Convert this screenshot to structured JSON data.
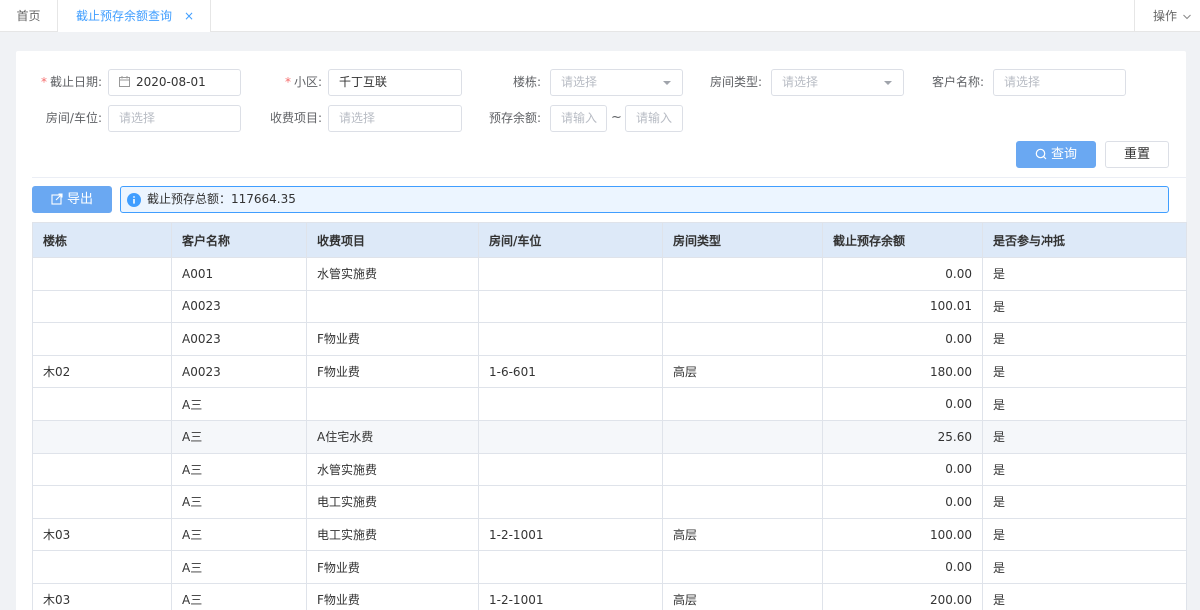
{
  "tabs": {
    "home": "首页",
    "active": "截止预存余额查询",
    "close": "×",
    "ops": "操作"
  },
  "filters": {
    "deadline_label": "截止日期:",
    "deadline_value": "2020-08-01",
    "community_label": "小区:",
    "community_value": "千丁互联",
    "building_label": "楼栋:",
    "building_placeholder": "请选择",
    "room_type_label": "房间类型:",
    "room_type_placeholder": "请选择",
    "customer_label": "客户名称:",
    "customer_placeholder": "请选择",
    "room_label": "房间/车位:",
    "room_placeholder": "请选择",
    "fee_label": "收费项目:",
    "fee_placeholder": "请选择",
    "balance_label": "预存余额:",
    "balance_min_placeholder": "请输入",
    "balance_tilde": "~",
    "balance_max_placeholder": "请输入",
    "required_mark": "*"
  },
  "actions": {
    "query": "查询",
    "reset": "重置",
    "export": "导出"
  },
  "summary": {
    "text": "截止预存总额：117664.35"
  },
  "table": {
    "columns": [
      "楼栋",
      "客户名称",
      "收费项目",
      "房间/车位",
      "房间类型",
      "截止预存余额",
      "是否参与冲抵"
    ],
    "rows": [
      {
        "building": "",
        "customer": "A001",
        "fee": "水管实施费",
        "room": "",
        "type": "",
        "balance": "0.00",
        "offset": "是"
      },
      {
        "building": "",
        "customer": "A0023",
        "fee": "",
        "room": "",
        "type": "",
        "balance": "100.01",
        "offset": "是"
      },
      {
        "building": "",
        "customer": "A0023",
        "fee": "F物业费",
        "room": "",
        "type": "",
        "balance": "0.00",
        "offset": "是"
      },
      {
        "building": "木02",
        "customer": "A0023",
        "fee": "F物业费",
        "room": "1-6-601",
        "type": "高层",
        "balance": "180.00",
        "offset": "是"
      },
      {
        "building": "",
        "customer": "A三",
        "fee": "",
        "room": "",
        "type": "",
        "balance": "0.00",
        "offset": "是"
      },
      {
        "building": "",
        "customer": "A三",
        "fee": "A住宅水费",
        "room": "",
        "type": "",
        "balance": "25.60",
        "offset": "是"
      },
      {
        "building": "",
        "customer": "A三",
        "fee": "水管实施费",
        "room": "",
        "type": "",
        "balance": "0.00",
        "offset": "是"
      },
      {
        "building": "",
        "customer": "A三",
        "fee": "电工实施费",
        "room": "",
        "type": "",
        "balance": "0.00",
        "offset": "是"
      },
      {
        "building": "木03",
        "customer": "A三",
        "fee": "电工实施费",
        "room": "1-2-1001",
        "type": "高层",
        "balance": "100.00",
        "offset": "是"
      },
      {
        "building": "",
        "customer": "A三",
        "fee": "F物业费",
        "room": "",
        "type": "",
        "balance": "0.00",
        "offset": "是"
      },
      {
        "building": "木03",
        "customer": "A三",
        "fee": "F物业费",
        "room": "1-2-1001",
        "type": "高层",
        "balance": "200.00",
        "offset": "是"
      }
    ]
  },
  "icons": {
    "calendar": "calendar-icon",
    "search": "search-icon",
    "export": "export-icon",
    "info": "info-icon",
    "dropdown": "chevron-down-icon"
  },
  "colors": {
    "accent": "#409eff",
    "primary_button": "#6aa8f2",
    "header_bg": "#dde9f8",
    "required": "#f56c6c"
  }
}
